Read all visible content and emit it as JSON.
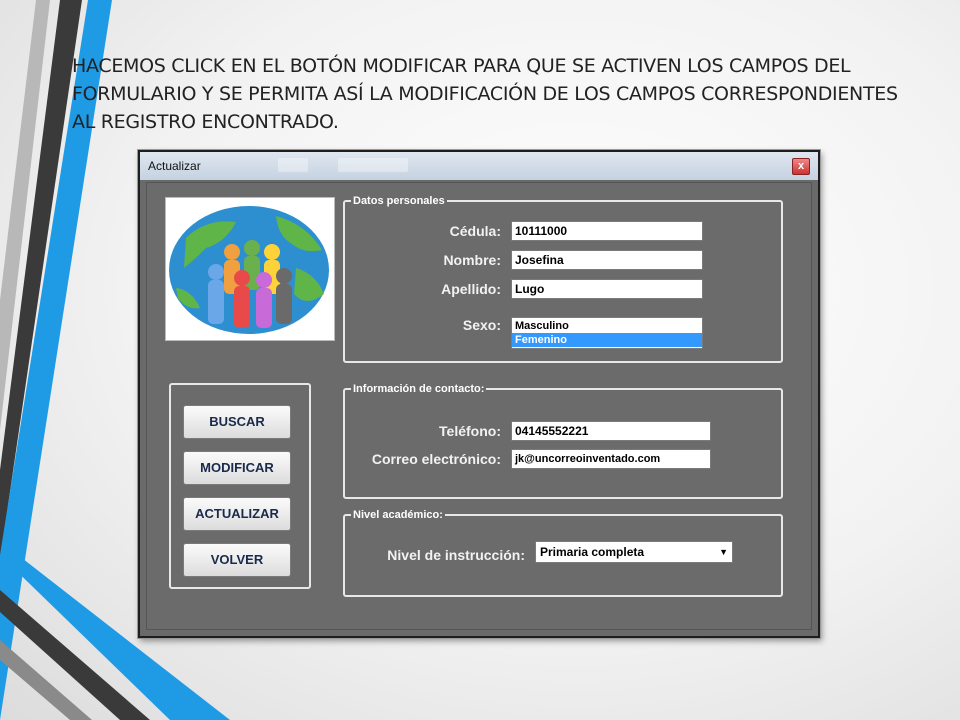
{
  "slide": {
    "instruction": "HACEMOS CLICK EN EL BOTÓN MODIFICAR PARA QUE SE ACTIVEN LOS CAMPOS DEL FORMULARIO Y SE PERMITA ASÍ LA MODIFICACIÓN DE LOS CAMPOS CORRESPONDIENTES AL REGISTRO ENCONTRADO."
  },
  "window": {
    "title": "Actualizar",
    "close_label": "x"
  },
  "datos_personales": {
    "legend": "Datos personales",
    "cedula_label": "Cédula:",
    "cedula_value": "10111000",
    "nombre_label": "Nombre:",
    "nombre_value": "Josefina",
    "apellido_label": "Apellido:",
    "apellido_value": "Lugo",
    "sexo_label": "Sexo:",
    "sexo_options": [
      "Masculino",
      "Femenino"
    ],
    "sexo_selected": "Femenino"
  },
  "contacto": {
    "legend": "Información de contacto:",
    "telefono_label": "Teléfono:",
    "telefono_value": "04145552221",
    "correo_label": "Correo electrónico:",
    "correo_value": "jk@uncorreoinventado.com"
  },
  "nivel": {
    "legend": "Nivel académico:",
    "instruccion_label": "Nivel de instrucción:",
    "instruccion_value": "Primaria completa",
    "dropdown_arrow": "▼"
  },
  "buttons": {
    "buscar": "BUSCAR",
    "modificar": "MODIFICAR",
    "actualizar": "ACTUALIZAR",
    "volver": "VOLVER"
  },
  "colors": {
    "window_bg": "#6b6b6b",
    "selection": "#3399ff",
    "stripe_blue": "#1f9be6",
    "stripe_dark": "#3a3a3a"
  }
}
